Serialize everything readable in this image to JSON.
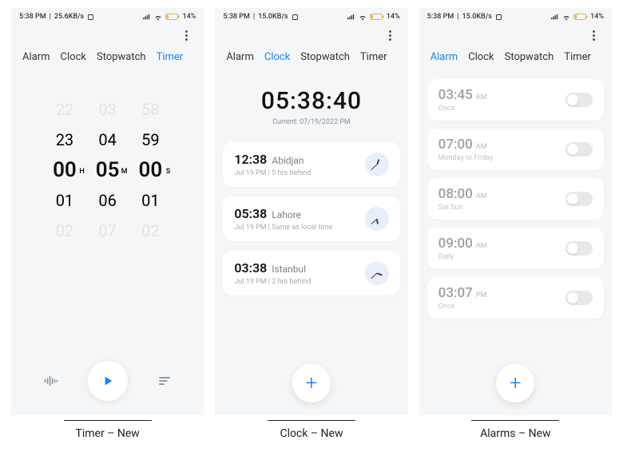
{
  "status": {
    "time": "5:38 PM",
    "battery_text": "14%",
    "speeds": [
      "25.6KB/s",
      "15.0KB/s",
      "15.0KB/s"
    ]
  },
  "tabs": {
    "alarm": "Alarm",
    "clock": "Clock",
    "stopwatch": "Stopwatch",
    "timer": "Timer"
  },
  "timer": {
    "h_sel": "00",
    "m_sel": "05",
    "s_sel": "00",
    "h_units": "H",
    "m_units": "M",
    "s_units": "S",
    "col_h": [
      "22",
      "23",
      "00",
      "01",
      "02"
    ],
    "col_m": [
      "03",
      "04",
      "05",
      "06",
      "07"
    ],
    "col_s": [
      "58",
      "59",
      "00",
      "01",
      "02"
    ]
  },
  "clock": {
    "big_time": "05:38:40",
    "current_label": "Current: 07/19/2022 PM",
    "cities": [
      {
        "time": "12:38",
        "name": "Abidjan",
        "sub": "Jul 19 PM  |  5 hrs behind",
        "hour_deg": 18,
        "min_deg": 228
      },
      {
        "time": "05:38",
        "name": "Lahore",
        "sub": "Jul 19 PM  |  Same as local time",
        "hour_deg": 169,
        "min_deg": 228
      },
      {
        "time": "03:38",
        "name": "Istanbul",
        "sub": "Jul 19 PM  |  2 hrs behind",
        "hour_deg": 109,
        "min_deg": 228
      }
    ]
  },
  "alarms": [
    {
      "time": "03:45",
      "ampm": "AM",
      "repeat": "Once"
    },
    {
      "time": "07:00",
      "ampm": "AM",
      "repeat": "Monday to Friday"
    },
    {
      "time": "08:00",
      "ampm": "AM",
      "repeat": "Sat Sun"
    },
    {
      "time": "09:00",
      "ampm": "AM",
      "repeat": "Daily"
    },
    {
      "time": "03:07",
      "ampm": "PM",
      "repeat": "Once"
    }
  ],
  "captions": {
    "timer": "Timer – New",
    "clock": "Clock – New",
    "alarms": "Alarms – New"
  }
}
